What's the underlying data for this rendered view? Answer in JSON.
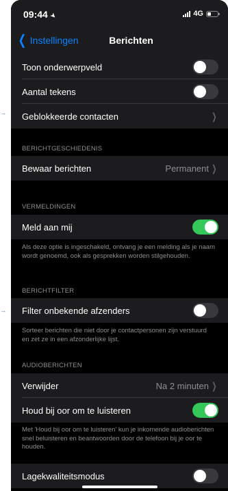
{
  "status_bar": {
    "time": "09:44",
    "network": "4G",
    "battery_level": 0.35
  },
  "nav": {
    "back_label": "Instellingen",
    "title": "Berichten"
  },
  "rows": {
    "show_subject": {
      "label": "Toon onderwerpveld",
      "on": false
    },
    "char_count": {
      "label": "Aantal tekens",
      "on": false
    },
    "blocked": {
      "label": "Geblokkeerde contacten"
    },
    "keep_messages": {
      "label": "Bewaar berichten",
      "value": "Permanent"
    },
    "notify_me": {
      "label": "Meld aan mij",
      "on": true
    },
    "filter_unknown": {
      "label": "Filter onbekende afzenders",
      "on": false
    },
    "expire": {
      "label": "Verwijder",
      "value": "Na 2 minuten"
    },
    "raise_to_listen": {
      "label": "Houd bij oor om te luisteren",
      "on": true
    },
    "low_quality": {
      "label": "Lagekwaliteitsmodus",
      "on": false
    }
  },
  "sections": {
    "history": "BERICHTGESCHIEDENIS",
    "mentions": "VERMELDINGEN",
    "filter": "BERICHTFILTER",
    "audio": "AUDIOBERICHTEN"
  },
  "footers": {
    "mentions": "Als deze optie is ingeschakeld, ontvang je een melding als je naam wordt genoemd, ook als gesprekken worden stilgehouden.",
    "filter": "Sorteer berichten die niet door je contactpersonen zijn verstuurd en zet ze in een afzonderlijke lijst.",
    "audio": "Met 'Houd bij oor om te luisteren' kun je inkomende audioberichten snel beluisteren en beantwoorden door de telefoon bij je oor te houden."
  },
  "colors": {
    "accent": "#0a84ff",
    "toggle_on": "#34c759",
    "toggle_off": "#39393d",
    "cell_bg": "#1c1c1e",
    "page_bg": "#000000"
  },
  "icons": {
    "back": "chevron-left-icon",
    "disclosure": "chevron-right-icon",
    "location": "location-arrow-icon"
  }
}
